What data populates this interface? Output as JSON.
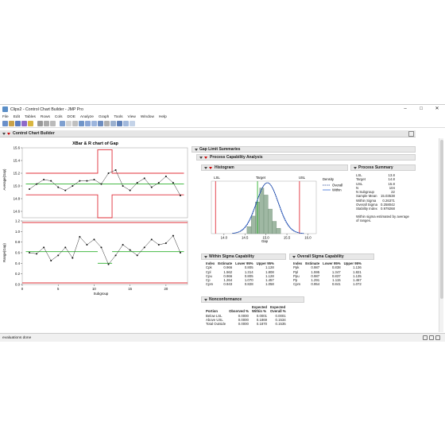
{
  "window": {
    "title": "Clips2 - Control Chart Builder - JMP Pro"
  },
  "menu": [
    "File",
    "Edit",
    "Tables",
    "Rows",
    "Cols",
    "DOE",
    "Analyze",
    "Graph",
    "Tools",
    "View",
    "Window",
    "Help"
  ],
  "panel": {
    "title": "Control Chart Builder"
  },
  "chart": {
    "title": "XBar & R chart of Gap",
    "y1label": "Average(Gap)",
    "y2label": "Range(Gap)",
    "xlabel": "Subgroup"
  },
  "chart_data": [
    {
      "type": "line",
      "title": "XBar & R chart of Gap",
      "ylabel": "Average(Gap)",
      "xlabel": "Subgroup",
      "ylim": [
        14.5,
        15.6
      ],
      "yticks": [
        "15.6",
        "15.4",
        "15.2",
        "15.0",
        "14.8",
        "14.6"
      ],
      "x": [
        1,
        2,
        3,
        4,
        5,
        6,
        7,
        8,
        9,
        10,
        11,
        12,
        13,
        14,
        15,
        16,
        17,
        18,
        19,
        20,
        21,
        22
      ],
      "values": [
        14.95,
        15.03,
        15.1,
        15.08,
        14.98,
        14.93,
        15.0,
        15.08,
        15.08,
        15.1,
        15.03,
        15.2,
        15.25,
        15.0,
        14.93,
        15.05,
        15.12,
        14.98,
        15.05,
        15.15,
        15.05,
        14.85
      ],
      "center": 15.03,
      "ucl_sub": 15.2,
      "lcl_sub": 14.86,
      "ucl_11_12": 15.57,
      "lcl_11_12": 14.5
    },
    {
      "type": "line",
      "ylabel": "Range(Gap)",
      "xlabel": "Subgroup",
      "ylim": [
        0,
        1.2
      ],
      "yticks": [
        "1.2",
        "1.0",
        "0.8",
        "0.6",
        "0.4",
        "0.2",
        "0.0"
      ],
      "xticks": [
        "0",
        "5",
        "10",
        "15",
        "20"
      ],
      "x": [
        1,
        2,
        3,
        4,
        5,
        6,
        7,
        8,
        9,
        10,
        11,
        12,
        13,
        14,
        15,
        16,
        17,
        18,
        19,
        20,
        21,
        22
      ],
      "values": [
        0.6,
        0.58,
        0.7,
        0.45,
        0.55,
        0.7,
        0.5,
        0.9,
        0.75,
        0.85,
        0.7,
        0.38,
        0.55,
        0.75,
        0.65,
        0.55,
        0.7,
        0.85,
        0.75,
        0.78,
        0.92,
        0.6
      ],
      "center": 0.62,
      "ucl": 1.32,
      "center_11_12": 0.4
    },
    {
      "type": "bar",
      "title": "Histogram",
      "xlabel": "Gap",
      "xticks": [
        "14.0",
        "14.5",
        "15.0",
        "15.5",
        "16.0"
      ],
      "categories": [
        "14.6",
        "14.7",
        "14.8",
        "14.9",
        "15.0",
        "15.1",
        "15.2",
        "15.3"
      ],
      "values": [
        4,
        10,
        18,
        26,
        22,
        14,
        7,
        3
      ],
      "LSL": 13.8,
      "Target": 14.8,
      "USL": 15.8
    }
  ],
  "summary": {
    "title": "Gap Limit Summaries"
  },
  "pca": {
    "title": "Process Capability Analysis"
  },
  "hist": {
    "title": "Histogram",
    "lsl": "LSL",
    "target": "Target",
    "usl": "USL",
    "xlabel": "Gap",
    "legend_title": "Density",
    "legend_overall": "Overall",
    "legend_within": "Within"
  },
  "ps": {
    "title": "Process Summary",
    "rows": [
      [
        "LSL",
        "13.8"
      ],
      [
        "Target",
        "14.8"
      ],
      [
        "USL",
        "15.8"
      ],
      [
        "N",
        "104"
      ],
      [
        "N Subgroup",
        "22"
      ],
      [
        "Sample Mean",
        "15.03538"
      ],
      [
        "Within Sigma",
        "0.26371"
      ],
      [
        "Overall Sigma",
        "0.258042"
      ],
      [
        "Stability Index",
        "0.979268"
      ]
    ],
    "note1": "Within sigma estimated by average",
    "note2": "of ranges."
  },
  "wsc": {
    "title": "Within Sigma Capability",
    "headers": [
      "Index",
      "Estimate",
      "Lower 95%",
      "Upper 95%"
    ],
    "rows": [
      [
        "Cpk",
        "0.966",
        "0.805",
        "1.128"
      ],
      [
        "Cpl",
        "1.562",
        "1.314",
        "1.808"
      ],
      [
        "Cpu",
        "0.966",
        "0.805",
        "1.128"
      ],
      [
        "Cp",
        "1.264",
        "1.070",
        "1.457"
      ],
      [
        "Cpm",
        "0.943",
        "0.828",
        "1.058"
      ]
    ]
  },
  "osc": {
    "title": "Overall Sigma Capability",
    "headers": [
      "Index",
      "Estimate",
      "Lower 95%",
      "Upper 95%"
    ],
    "rows": [
      [
        "Ppk",
        "0.987",
        "0.838",
        "1.136"
      ],
      [
        "Ppl",
        "1.595",
        "1.347",
        "1.821"
      ],
      [
        "Ppu",
        "0.987",
        "0.837",
        "1.135"
      ],
      [
        "Pp",
        "1.291",
        "1.115",
        "1.467"
      ],
      [
        "Cpm",
        "0.954",
        "0.841",
        "1.072"
      ]
    ]
  },
  "nc": {
    "title": "Nonconformance",
    "h1": "Expected",
    "h2": "Expected",
    "headers": [
      "Portion",
      "Observed %",
      "Within %",
      "Overall %"
    ],
    "rows": [
      [
        "Below LSL",
        "0.0000",
        "0.0001",
        "0.0001"
      ],
      [
        "Above USL",
        "0.0000",
        "0.1869",
        "0.1534"
      ],
      [
        "Total Outside",
        "0.0000",
        "0.1870",
        "0.1535"
      ]
    ]
  },
  "status": {
    "text": "evaluations done"
  },
  "colors": {
    "limit": "#e0303a",
    "center": "#2db02d",
    "hist": "#9fb8a3",
    "overall": "#1a3a8c",
    "within": "#3a6fd8"
  }
}
